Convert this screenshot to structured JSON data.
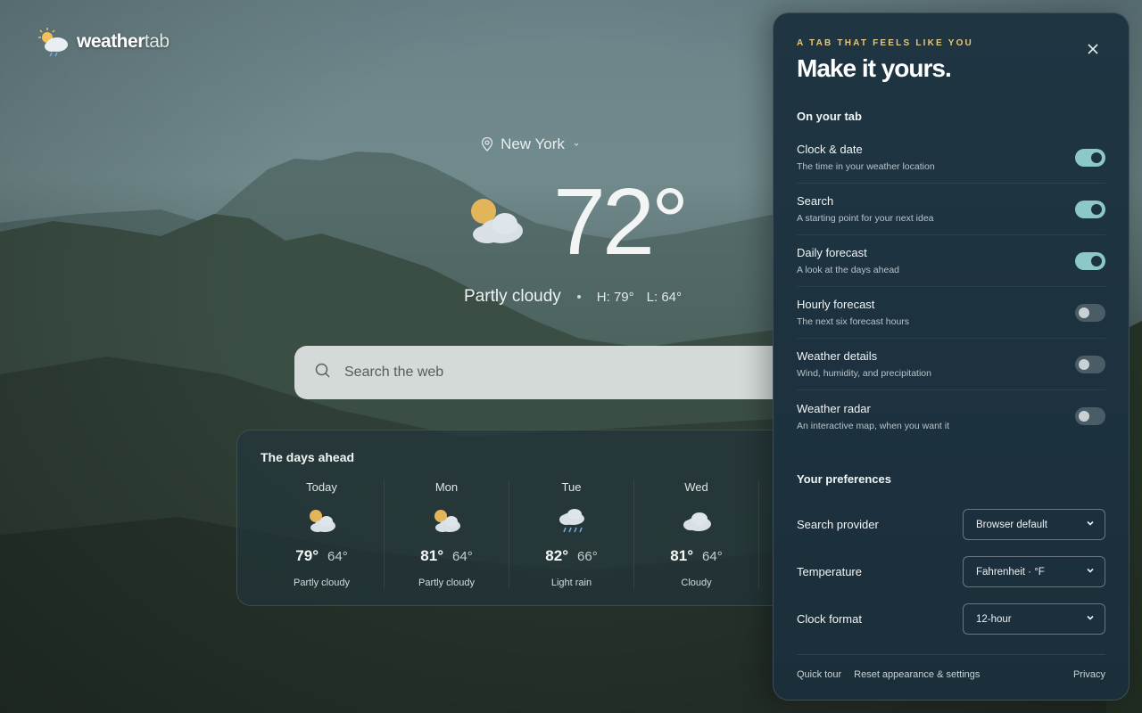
{
  "brand": {
    "name_bold": "weather",
    "name_light": "tab"
  },
  "location": {
    "name": "New York"
  },
  "current": {
    "temp": "72°",
    "condition": "Partly cloudy",
    "high": "H: 79°",
    "low": "L: 64°"
  },
  "search": {
    "placeholder": "Search the web"
  },
  "days": {
    "title": "The days ahead",
    "items": [
      {
        "day": "Today",
        "icon": "partly-cloudy-icon",
        "hi": "79°",
        "lo": "64°",
        "cond": "Partly cloudy"
      },
      {
        "day": "Mon",
        "icon": "partly-cloudy-icon",
        "hi": "81°",
        "lo": "64°",
        "cond": "Partly cloudy"
      },
      {
        "day": "Tue",
        "icon": "rain-icon",
        "hi": "82°",
        "lo": "66°",
        "cond": "Light rain"
      },
      {
        "day": "Wed",
        "icon": "cloud-icon",
        "hi": "81°",
        "lo": "64°",
        "cond": "Cloudy"
      }
    ]
  },
  "panel": {
    "kicker": "A TAB THAT FEELS LIKE YOU",
    "title": "Make it yours.",
    "on_tab_title": "On your tab",
    "toggles": [
      {
        "label": "Clock & date",
        "desc": "The time in your weather location",
        "on": true
      },
      {
        "label": "Search",
        "desc": "A starting point for your next idea",
        "on": true
      },
      {
        "label": "Daily forecast",
        "desc": "A look at the days ahead",
        "on": true
      },
      {
        "label": "Hourly forecast",
        "desc": "The next six forecast hours",
        "on": false
      },
      {
        "label": "Weather details",
        "desc": "Wind, humidity, and precipitation",
        "on": false
      },
      {
        "label": "Weather radar",
        "desc": "An interactive map, when you want it",
        "on": false
      }
    ],
    "prefs_title": "Your preferences",
    "prefs": [
      {
        "label": "Search provider",
        "value": "Browser default"
      },
      {
        "label": "Temperature",
        "value": "Fahrenheit · °F"
      },
      {
        "label": "Clock format",
        "value": "12-hour"
      }
    ],
    "footer": {
      "tour": "Quick tour",
      "reset": "Reset appearance & settings",
      "privacy": "Privacy"
    }
  },
  "colors": {
    "accent_gold": "#e8c77a",
    "toggle_on": "#8cc8c8",
    "panel_bg": "#1f3542"
  }
}
